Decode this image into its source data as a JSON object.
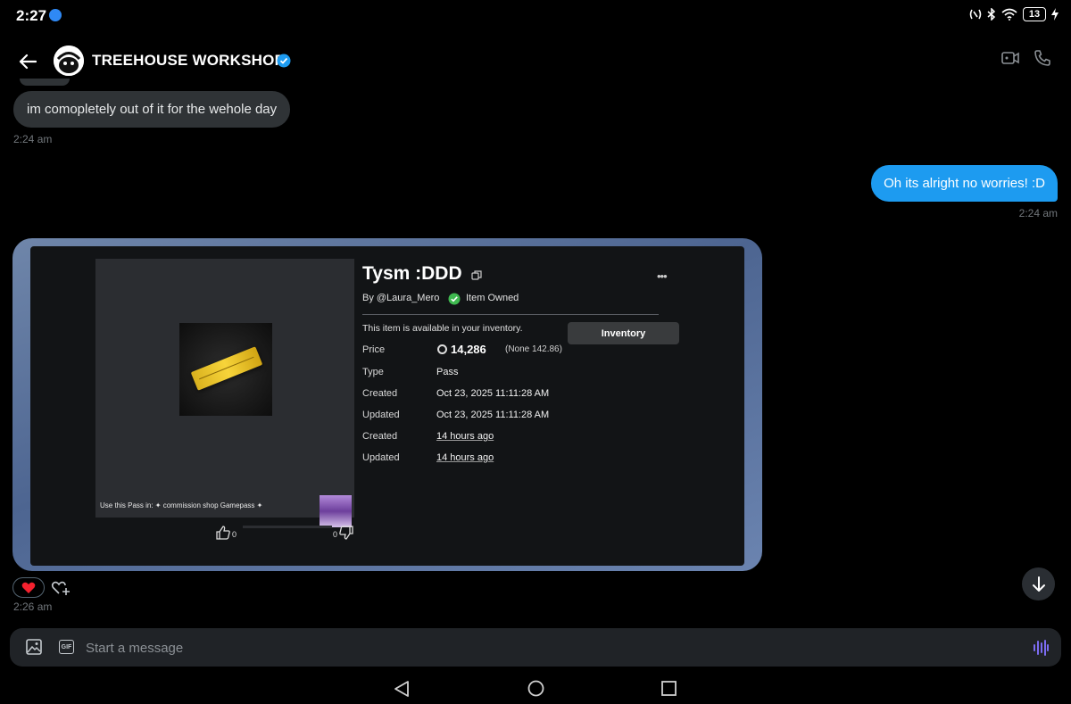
{
  "status_bar": {
    "time": "2:27",
    "battery": "13"
  },
  "header": {
    "title": "TREEHOUSE WORKSHOP"
  },
  "messages": {
    "incoming_1": "im comopletely out of it for the wehole day",
    "incoming_1_time": "2:24 am",
    "outgoing_1": "Oh its alright no worries! :D",
    "outgoing_1_time": "2:24 am",
    "image_time": "2:26 am"
  },
  "shared_image": {
    "title": "Tysm :DDD",
    "by": "By @Laura_Mero",
    "owned": "Item Owned",
    "available": "This item is available in your inventory.",
    "inventory_button": "Inventory",
    "more": "•••",
    "rows": [
      {
        "label": "Price",
        "value": ""
      },
      {
        "label": "Type",
        "value": "Pass"
      },
      {
        "label": "Created",
        "value": "Oct 23, 2025 11:11:28 AM"
      },
      {
        "label": "Updated",
        "value": "Oct 23, 2025 11:11:28 AM"
      },
      {
        "label": "Created",
        "value": "14 hours ago"
      },
      {
        "label": "Updated",
        "value": "14 hours ago"
      }
    ],
    "price": "14,286",
    "price_note": "(None 142.86)",
    "caption": "Use this Pass in: ✦ commission shop Gamepass ✦",
    "likes": "0",
    "dislikes": "0"
  },
  "reactions": {
    "heart": "❤️"
  },
  "composer": {
    "placeholder": "Start a message",
    "gif_label": "GIF"
  },
  "colors": {
    "outgoing_bubble": "#1d9bf0",
    "incoming_bubble": "#2f3336",
    "accent_verified": "#1d9bf0"
  }
}
